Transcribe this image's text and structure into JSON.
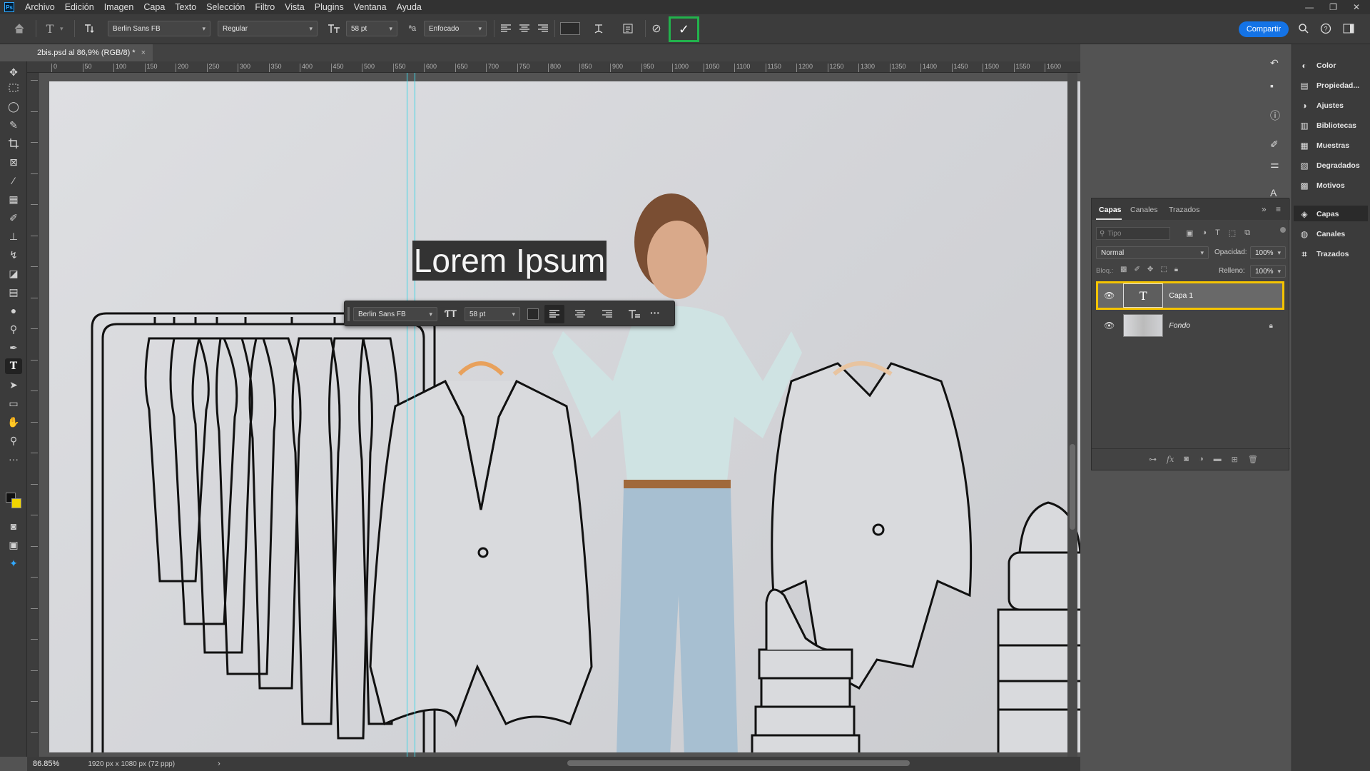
{
  "app": {
    "logo": "Ps",
    "menu": [
      "Archivo",
      "Edición",
      "Imagen",
      "Capa",
      "Texto",
      "Selección",
      "Filtro",
      "Vista",
      "Plugins",
      "Ventana",
      "Ayuda"
    ]
  },
  "options_bar": {
    "font_family": "Berlin Sans FB",
    "font_style": "Regular",
    "font_size": "58 pt",
    "aa_label": "ªa",
    "antialias": "Enfocado",
    "commit_symbol": "✓",
    "cancel_symbol": "⊘",
    "share_label": "Compartir"
  },
  "document": {
    "tab_title": "2bis.psd al 86,9% (RGB/8) *",
    "close_symbol": "×"
  },
  "canvas": {
    "text_layer_content": "Lorem Ipsum"
  },
  "floating_text_bar": {
    "font_family": "Berlin Sans FB",
    "font_size": "58 pt",
    "more_symbol": "···"
  },
  "ruler_top_labels": [
    "0",
    "50",
    "100",
    "150",
    "200",
    "250",
    "300",
    "350",
    "400",
    "450",
    "500",
    "550",
    "600",
    "650",
    "700",
    "750",
    "800",
    "850",
    "900",
    "950",
    "1000",
    "1050",
    "1100",
    "1150",
    "1200",
    "1250",
    "1300",
    "1350",
    "1400",
    "1450",
    "1500",
    "1550",
    "1600",
    "1650",
    "1700",
    "1750",
    "1800",
    "1850",
    "1900"
  ],
  "right_dock": {
    "items": [
      "Color",
      "Propiedad...",
      "Ajustes",
      "Bibliotecas",
      "Muestras",
      "Degradados",
      "Motivos",
      "Capas",
      "Canales",
      "Trazados"
    ]
  },
  "layers_panel": {
    "tabs": [
      "Capas",
      "Canales",
      "Trazados"
    ],
    "search_placeholder": "Tipo",
    "blend_mode": "Normal",
    "opacity_label": "Opacidad:",
    "opacity_value": "100%",
    "lock_label": "Bloq.:",
    "fill_label": "Relleno:",
    "fill_value": "100%",
    "layers": [
      {
        "name": "Capa 1",
        "thumb": "T",
        "selected": true
      },
      {
        "name": "Fondo",
        "locked": true
      }
    ],
    "footer_icons": [
      "link-icon",
      "fx-icon",
      "mask-icon",
      "adjustment-icon",
      "folder-icon",
      "new-layer-icon",
      "trash-icon"
    ]
  },
  "status_bar": {
    "zoom": "86.85%",
    "doc_info": "1920 px x 1080 px (72 ppp)"
  },
  "colors": {
    "accent_blue": "#1473e6",
    "commit_highlight": "#22b24c",
    "selected_layer_highlight": "#f5c400",
    "guide_cyan": "#3fd6e6",
    "text_selection_bg": "#333333"
  }
}
